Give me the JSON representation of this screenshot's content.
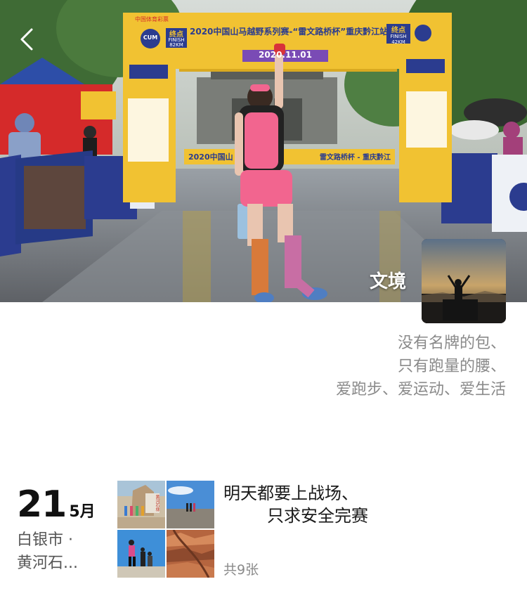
{
  "header": {
    "back_icon": "chevron-left-icon",
    "nickname": "文境"
  },
  "cover": {
    "arch_title": "2020中国山马越野系列赛-“雷文路桥杯”重庆黔江站",
    "arch_date": "2020.11.01",
    "finish_label": "终点",
    "finish_sub": "FINISH",
    "finish_km": "82KM",
    "finish_km_right": "42KM",
    "brand_logo": "CUM",
    "sponsor_top": "中国体育彩票",
    "banner_text": "2020中国山",
    "banner_text2": "雷文路桥杯 - 重庆黔江"
  },
  "profile": {
    "signature_lines": [
      "没有名牌的包、",
      "只有跑量的腰、",
      "爱跑步、爱运动、爱生活"
    ]
  },
  "post": {
    "day": "21",
    "month": "5月",
    "location_line1": "白银市 ·",
    "location_line2": "黄河石...",
    "thumb4_text": "",
    "thumb1_text": "黄河石林",
    "text_line1": "明天都要上战场、",
    "text_line2": "只求安全完赛",
    "photo_count": "共9张"
  },
  "colors": {
    "arch_yellow": "#f1c232",
    "arch_blue": "#2b3c8f",
    "runner_pink": "#f2658f",
    "muted_text": "#8a8a8a"
  }
}
